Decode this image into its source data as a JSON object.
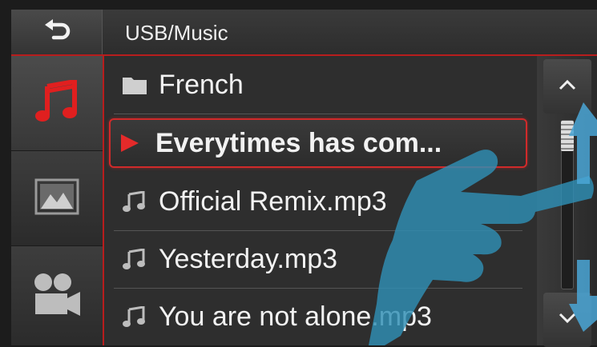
{
  "header": {
    "path": "USB/Music"
  },
  "sidebar": {
    "items": [
      {
        "icon": "music-note-icon",
        "active": true
      },
      {
        "icon": "image-icon",
        "active": false
      },
      {
        "icon": "video-camera-icon",
        "active": false
      }
    ]
  },
  "list": {
    "items": [
      {
        "type": "folder",
        "icon": "folder-icon",
        "label": "French"
      },
      {
        "type": "playing",
        "icon": "play-icon",
        "label": "Everytimes has com...",
        "selected": true
      },
      {
        "type": "file",
        "icon": "music-note-icon",
        "label": "Official Remix.mp3"
      },
      {
        "type": "file",
        "icon": "music-note-icon",
        "label": "Yesterday.mp3"
      },
      {
        "type": "file",
        "icon": "music-note-icon",
        "label": "You are not alone.mp3"
      }
    ]
  },
  "colors": {
    "accent": "#d12a2a",
    "background": "#2e2e2e",
    "text": "#f2f2f2",
    "hand_overlay": "#2f8fb5"
  }
}
